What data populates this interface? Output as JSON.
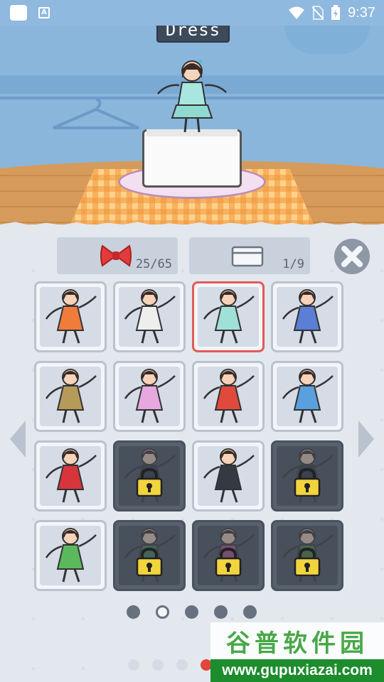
{
  "status_bar": {
    "time": "9:37",
    "app_badge": "A"
  },
  "title": "Dress",
  "counters": {
    "bows": "25/65",
    "boxes": "1/9"
  },
  "outfits": [
    {
      "name": "orange-floral-dress",
      "locked": false,
      "selected": false,
      "color": "#f07c3c"
    },
    {
      "name": "white-ghost-dress",
      "locked": false,
      "selected": false,
      "color": "#eeeeee"
    },
    {
      "name": "mint-striped-dress",
      "locked": false,
      "selected": true,
      "color": "#9fe0d8"
    },
    {
      "name": "cheerleader",
      "locked": false,
      "selected": false,
      "color": "#5b7fd6"
    },
    {
      "name": "tribal-spear",
      "locked": false,
      "selected": false,
      "color": "#b59a5a"
    },
    {
      "name": "pink-bunny-suit",
      "locked": false,
      "selected": false,
      "color": "#e7a8e0"
    },
    {
      "name": "basketball",
      "locked": false,
      "selected": false,
      "color": "#e04a3c"
    },
    {
      "name": "tennis",
      "locked": false,
      "selected": false,
      "color": "#5aa0de"
    },
    {
      "name": "shrine-maiden",
      "locked": false,
      "selected": false,
      "color": "#d8343c"
    },
    {
      "name": "locked-ninja",
      "locked": true,
      "selected": false,
      "color": "#2a3140"
    },
    {
      "name": "business-suit",
      "locked": false,
      "selected": false,
      "color": "#333a44"
    },
    {
      "name": "locked-robe",
      "locked": true,
      "selected": false,
      "color": "#2a3140"
    },
    {
      "name": "hula",
      "locked": false,
      "selected": false,
      "color": "#5cb85c"
    },
    {
      "name": "locked-fairy",
      "locked": true,
      "selected": false,
      "color": "#3c7a5a"
    },
    {
      "name": "locked-party",
      "locked": true,
      "selected": false,
      "color": "#b04a8a"
    },
    {
      "name": "locked-sword",
      "locked": true,
      "selected": false,
      "color": "#4a7a3a"
    }
  ],
  "pager": {
    "count": 5,
    "active": 1
  },
  "pager2": {
    "count": 4,
    "red": 3
  },
  "watermark": {
    "chinese": "谷普软件园",
    "url": "www.gupuxiazai.com"
  },
  "colors": {
    "sky": "#8ab6dc",
    "panel": "#e3e7ee",
    "selected": "#e25b55",
    "lock": "#f2d43c"
  }
}
